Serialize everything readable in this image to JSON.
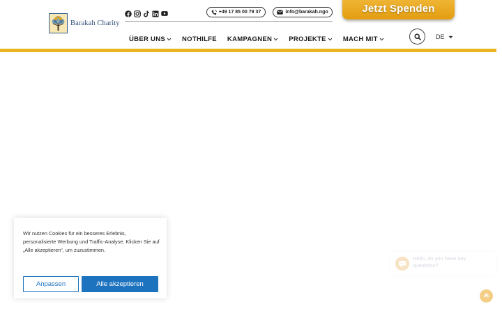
{
  "brand": {
    "name": "Barakah Charity",
    "color_blue": "#2f4e7a",
    "color_gold": "#e8b51f"
  },
  "socials": [
    {
      "icon": "facebook-icon"
    },
    {
      "icon": "instagram-icon"
    },
    {
      "icon": "tiktok-icon"
    },
    {
      "icon": "linkedin-icon"
    },
    {
      "icon": "youtube-icon"
    }
  ],
  "contact": {
    "phone": "+49 17 85 00 79 37",
    "email": "info@barakah.ngo"
  },
  "donate": {
    "label": "Jetzt Spenden",
    "color": "#e8a823"
  },
  "nav": {
    "items": [
      {
        "label": "ÜBER UNS",
        "has_dropdown": true
      },
      {
        "label": "NOTHILFE",
        "has_dropdown": false
      },
      {
        "label": "KAMPAGNEN",
        "has_dropdown": true
      },
      {
        "label": "PROJEKTE",
        "has_dropdown": true
      },
      {
        "label": "MACH MIT",
        "has_dropdown": true
      }
    ]
  },
  "language": {
    "current": "DE"
  },
  "cookie": {
    "text": "Wir nutzen Cookies für ein besseres Erlebnis, personalisierte Werbung und Traffic-Analyse. Klicken Sie auf „Alle akzeptieren“, um zuzustimmen.",
    "customize_label": "Anpassen",
    "accept_label": "Alle akzeptieren",
    "accent": "#1e73be"
  },
  "chat": {
    "message": "Hello, do you have any questions?"
  }
}
